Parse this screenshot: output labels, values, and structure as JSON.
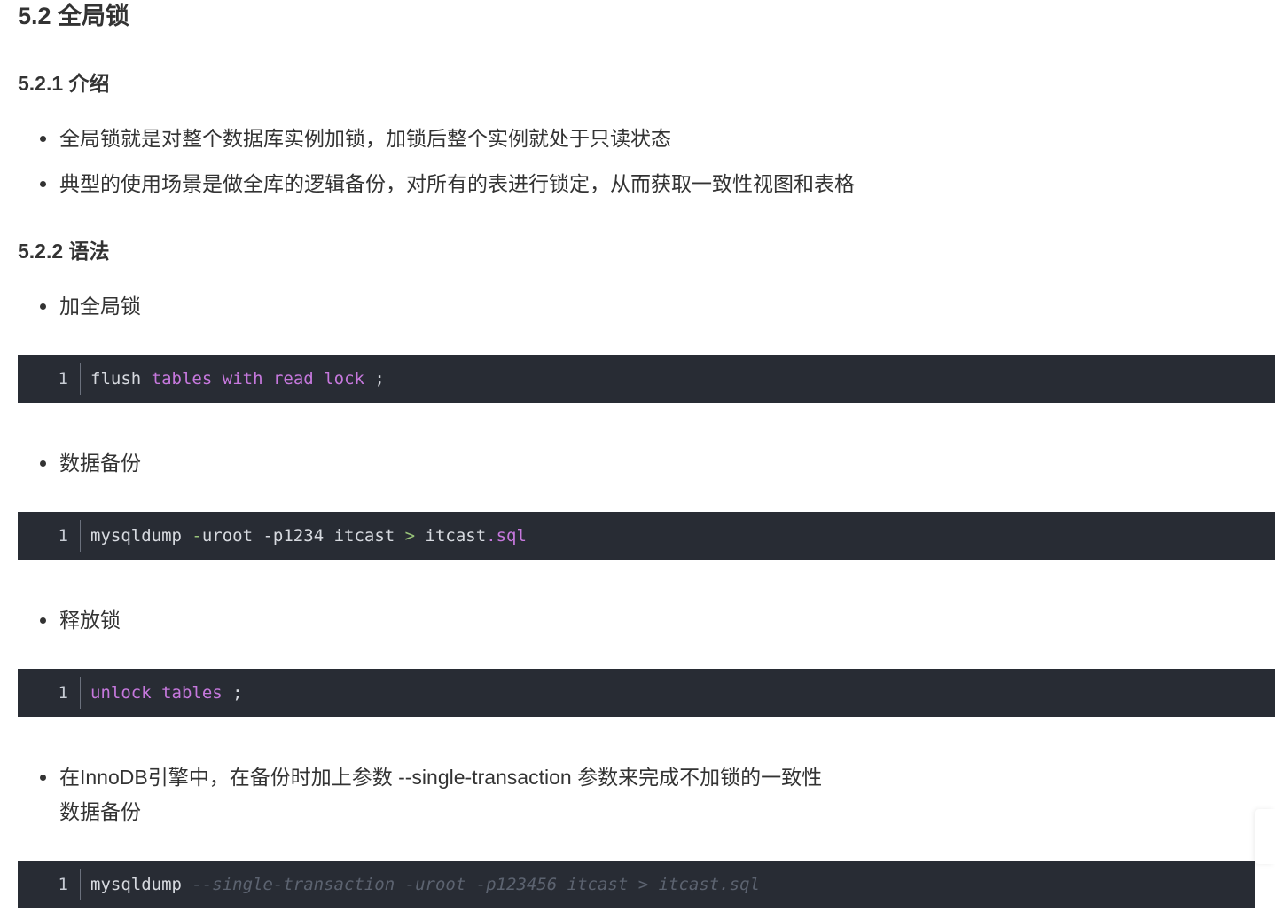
{
  "heading_main": "5.2 全局锁",
  "section_intro": {
    "heading": "5.2.1 介绍",
    "bullets": [
      "全局锁就是对整个数据库实例加锁，加锁后整个实例就处于只读状态",
      "典型的使用场景是做全库的逻辑备份，对所有的表进行锁定，从而获取一致性视图和表格"
    ]
  },
  "section_syntax": {
    "heading": "5.2.2 语法",
    "items": [
      {
        "label": "加全局锁",
        "line_no": "1",
        "tokens": [
          "flush",
          " ",
          "tables",
          " ",
          "with",
          " ",
          "read",
          " ",
          "lock",
          " ;"
        ]
      },
      {
        "label": "数据备份",
        "line_no": "1",
        "tokens": [
          "mysqldump",
          " ",
          "-",
          "uroot -p1234 itcast ",
          ">",
          " itcast",
          ".sql"
        ]
      },
      {
        "label": "释放锁",
        "line_no": "1",
        "tokens": [
          "unlock",
          " ",
          "tables",
          " ;"
        ]
      },
      {
        "label": "在InnoDB引擎中，在备份时加上参数 --single-transaction 参数来完成不加锁的一致性数据备份",
        "line_no": "1",
        "tokens": [
          "mysqldump",
          " ",
          "--single-transaction -uroot -p123456 itcast > itcast.sql"
        ]
      }
    ]
  },
  "colors": {
    "code_bg": "#282c34",
    "keyword": "#c678dd",
    "plain": "#d7dae0",
    "comment": "#5c6370",
    "operator": "#98c379"
  }
}
